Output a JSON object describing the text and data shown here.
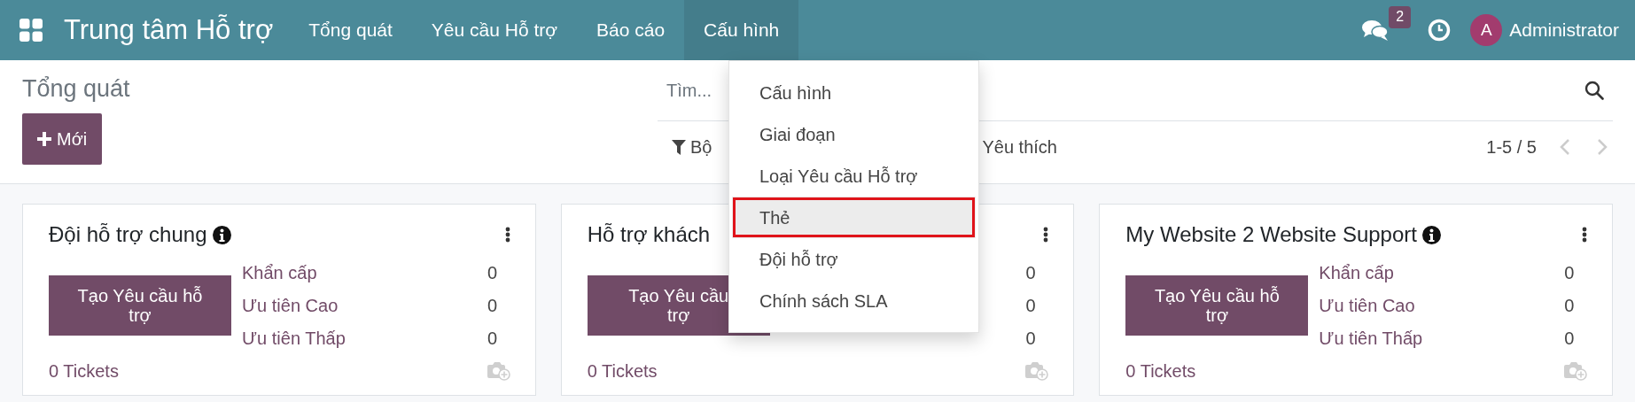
{
  "navbar": {
    "brand": "Trung tâm Hỗ trợ",
    "menu": [
      {
        "label": "Tổng quát",
        "selected": false
      },
      {
        "label": "Yêu cầu Hỗ trợ",
        "selected": false
      },
      {
        "label": "Báo cáo",
        "selected": false
      },
      {
        "label": "Cấu hình",
        "selected": true
      }
    ],
    "messages_badge": "2",
    "user": {
      "initial": "A",
      "name": "Administrator"
    }
  },
  "control_panel": {
    "title": "Tổng quát",
    "new_button": "Mới",
    "search": {
      "placeholder": "Tìm..."
    },
    "filter_button": "Bộ",
    "favorites_button": "Yêu thích",
    "pager": "1-5 / 5"
  },
  "config_menu": {
    "items": [
      {
        "label": "Cấu hình",
        "highlighted": false
      },
      {
        "label": "Giai đoạn",
        "highlighted": false
      },
      {
        "label": "Loại Yêu cầu Hỗ trợ",
        "highlighted": false
      },
      {
        "label": "Thẻ",
        "highlighted": true
      },
      {
        "label": "Đội hỗ trợ",
        "highlighted": false
      },
      {
        "label": "Chính sách SLA",
        "highlighted": false
      }
    ]
  },
  "teams": [
    {
      "title": "Đội hỗ trợ chung",
      "info": true,
      "button_lines": [
        "Tạo Yêu cầu hỗ",
        "trợ"
      ],
      "stats": [
        {
          "label": "Khẩn cấp",
          "count": "0"
        },
        {
          "label": "Ưu tiên Cao",
          "count": "0"
        },
        {
          "label": "Ưu tiên Thấp",
          "count": "0"
        }
      ],
      "tickets": "0 Tickets"
    },
    {
      "title": "Hỗ trợ khách",
      "info": false,
      "button_lines": [
        "Tạo Yêu cầu",
        "trợ"
      ],
      "stats": [
        {
          "count": "0"
        },
        {
          "count": "0"
        },
        {
          "count": "0"
        }
      ],
      "tickets": "0 Tickets"
    },
    {
      "title": "My Website 2 Website Support",
      "info": true,
      "button_lines": [
        "Tạo Yêu cầu hỗ",
        "trợ"
      ],
      "stats": [
        {
          "label": "Khẩn cấp",
          "count": "0"
        },
        {
          "label": "Ưu tiên Cao",
          "count": "0"
        },
        {
          "label": "Ưu tiên Thấp",
          "count": "0"
        }
      ],
      "tickets": "0 Tickets"
    }
  ]
}
